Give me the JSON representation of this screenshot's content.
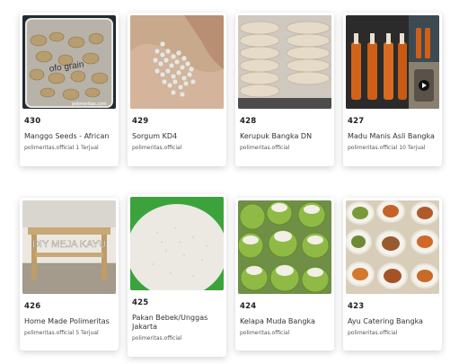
{
  "products": [
    {
      "id": "430",
      "title": "Manggo Seeds - African",
      "seller": "polimeritas.official",
      "sold": "1 Terjual",
      "image_icon": "seeds-photo"
    },
    {
      "id": "429",
      "title": "Sorgum KD4",
      "seller": "polimeritas.official",
      "sold": "",
      "image_icon": "sorghum-grain-photo"
    },
    {
      "id": "428",
      "title": "Kerupuk Bangka DN",
      "seller": "polimeritas.official",
      "sold": "",
      "image_icon": "crackers-photo"
    },
    {
      "id": "427",
      "title": "Madu Manis Asli Bangka",
      "seller": "polimeritas.official",
      "sold": "10 Terjual",
      "image_icon": "honey-bottles-photo"
    },
    {
      "id": "426",
      "title": "Home Made Polimeritas",
      "seller": "polimeritas.official",
      "sold": "5 Terjual",
      "image_icon": "wooden-table-photo"
    },
    {
      "id": "425",
      "title": "Pakan Bebek/Unggas Jakarta",
      "seller": "polimeritas.official",
      "sold": "",
      "image_icon": "duck-feed-photo"
    },
    {
      "id": "424",
      "title": "Kelapa Muda Bangka",
      "seller": "polimeritas.official",
      "sold": "",
      "image_icon": "young-coconut-photo"
    },
    {
      "id": "423",
      "title": "Ayu Catering Bangka",
      "seller": "polimeritas.official",
      "sold": "",
      "image_icon": "catering-dishes-photo"
    }
  ],
  "image_texts": {
    "p0_bag_label": "ofo grain",
    "p0_watermark": "polimeritas.com",
    "p4_overlay": "DIY MEJA KAYU"
  },
  "colors": {
    "card_bg": "#ffffff",
    "title": "#333333",
    "meta": "#555555"
  }
}
